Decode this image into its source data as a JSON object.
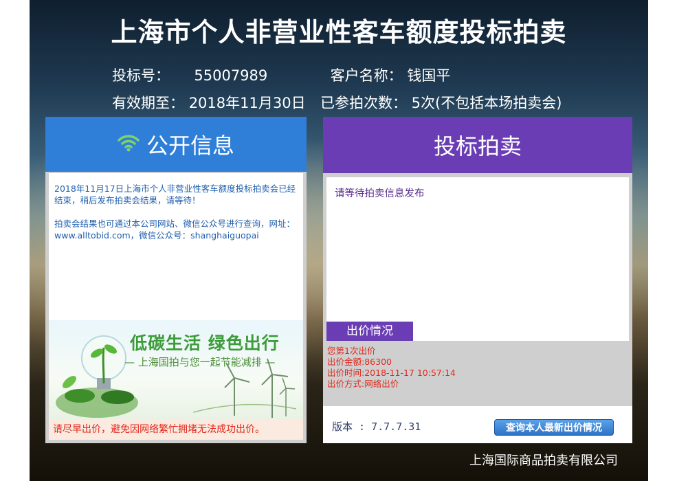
{
  "title": "上海市个人非营业性客车额度投标拍卖",
  "bidder": {
    "bid_no_label": "投标号：",
    "bid_no": "55007989",
    "customer_label": "客户名称：",
    "customer_name": "钱国平",
    "validity_label": "有效期至：",
    "validity_date": "2018年11月30日",
    "participation_label": "已参拍次数：",
    "participation_value": "5次(不包括本场拍卖会)"
  },
  "left_panel": {
    "header": "公开信息",
    "header_icon": "wifi-icon",
    "paragraphs": [
      "2018年11月17日上海市个人非营业性客车额度投标拍卖会已经结束，稍后发布拍卖会结果，请等待！",
      "拍卖会结果也可通过本公司网站、微信公众号进行查询，网址：www.alltobid.com，微信公众号：shanghaiguopai"
    ],
    "banner_title": "低碳生活 绿色出行",
    "banner_subtitle": "— 上海国拍与您一起节能减排 —",
    "notice": "请尽早出价，避免因网络繁忙拥堵无法成功出价。"
  },
  "right_panel": {
    "header": "投标拍卖",
    "message": "请等待拍卖信息发布",
    "bid_tab": "出价情况",
    "bid_lines": [
      "您第1次出价",
      "出价金额:86300",
      "出价时间:2018-11-17 10:57:14",
      "出价方式:网络出价"
    ],
    "version": "版本 : 7.7.7.31",
    "query_button": "查询本人最新出价情况"
  },
  "footer_company": "上海国际商品拍卖有限公司",
  "colors": {
    "left_header": "#2f7fd8",
    "right_header": "#6a3db5",
    "notice_text": "#e0281c",
    "info_text": "#1f5fae"
  }
}
